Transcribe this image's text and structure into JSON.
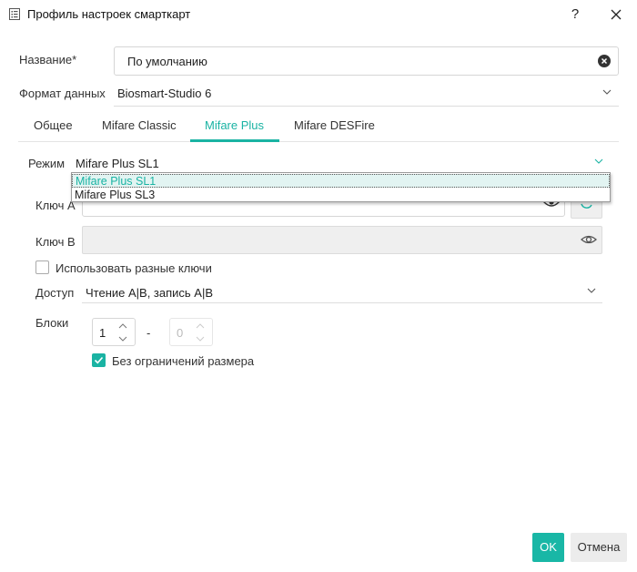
{
  "window": {
    "title": "Профиль настроек смарткарт",
    "help_label": "?",
    "close_label": "✕"
  },
  "name_field": {
    "label": "Название*",
    "value": "По умолчанию"
  },
  "data_format": {
    "label": "Формат данных",
    "value": "Biosmart-Studio 6"
  },
  "tabs": [
    {
      "label": "Общее",
      "active": false
    },
    {
      "label": "Mifare Classic",
      "active": false
    },
    {
      "label": "Mifare Plus",
      "active": true
    },
    {
      "label": "Mifare DESFire",
      "active": false
    }
  ],
  "mode": {
    "label": "Режим",
    "value": "Mifare Plus SL1",
    "options": [
      "Mifare Plus SL1",
      "Mifare Plus SL3"
    ]
  },
  "key_a": {
    "label": "Ключ А",
    "value": ""
  },
  "key_b": {
    "label": "Ключ В",
    "value": ""
  },
  "use_different_keys": {
    "label": "Использовать разные ключи",
    "checked": false
  },
  "access": {
    "label": "Доступ",
    "value": "Чтение А|В, запись А|В"
  },
  "blocks": {
    "label": "Блоки",
    "from": "1",
    "separator": "-",
    "to": "0"
  },
  "no_size_limit": {
    "label": "Без ограничений размера",
    "checked": true
  },
  "buttons": {
    "ok": "OK",
    "cancel": "Отмена"
  },
  "colors": {
    "accent": "#1ab3a3",
    "ok_button": "#19b7a6"
  },
  "icons": [
    "list-icon",
    "clear-icon",
    "chevron-down-icon",
    "eye-icon",
    "refresh-icon",
    "checkmark-icon"
  ]
}
